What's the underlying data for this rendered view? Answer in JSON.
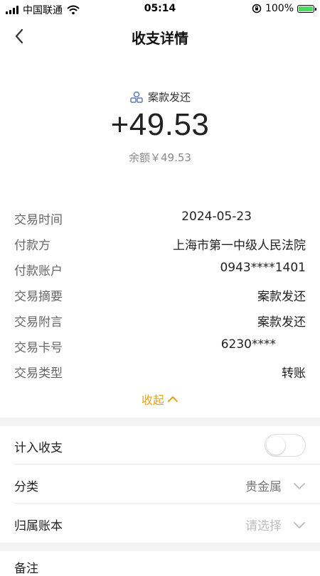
{
  "status_bar": {
    "carrier": "中国联通",
    "time": "05:14",
    "battery": "100%",
    "battery_level": 1.0
  },
  "nav": {
    "title": "收支详情"
  },
  "summary": {
    "category_tag": "案款发还",
    "amount": "+49.53",
    "balance": "余额￥49.53"
  },
  "details": [
    {
      "label": "交易时间",
      "value": "2024-05-23"
    },
    {
      "label": "付款方",
      "value": "上海市第一中级人民法院"
    },
    {
      "label": "付款账户",
      "value": "0943****1401"
    },
    {
      "label": "交易摘要",
      "value": "案款发还"
    },
    {
      "label": "交易附言",
      "value": "案款发还"
    },
    {
      "label": "交易卡号",
      "value": "6230****"
    },
    {
      "label": "交易类型",
      "value": "转账"
    }
  ],
  "collapse_label": "收起",
  "settings": {
    "include_label": "计入收支",
    "include_on": false,
    "category_label": "分类",
    "category_value": "贵金属",
    "ledger_label": "归属账本",
    "ledger_placeholder": "请选择"
  },
  "note_label": "备注",
  "colors": {
    "accent": "#e8a21c",
    "battery": "#4cd964"
  }
}
